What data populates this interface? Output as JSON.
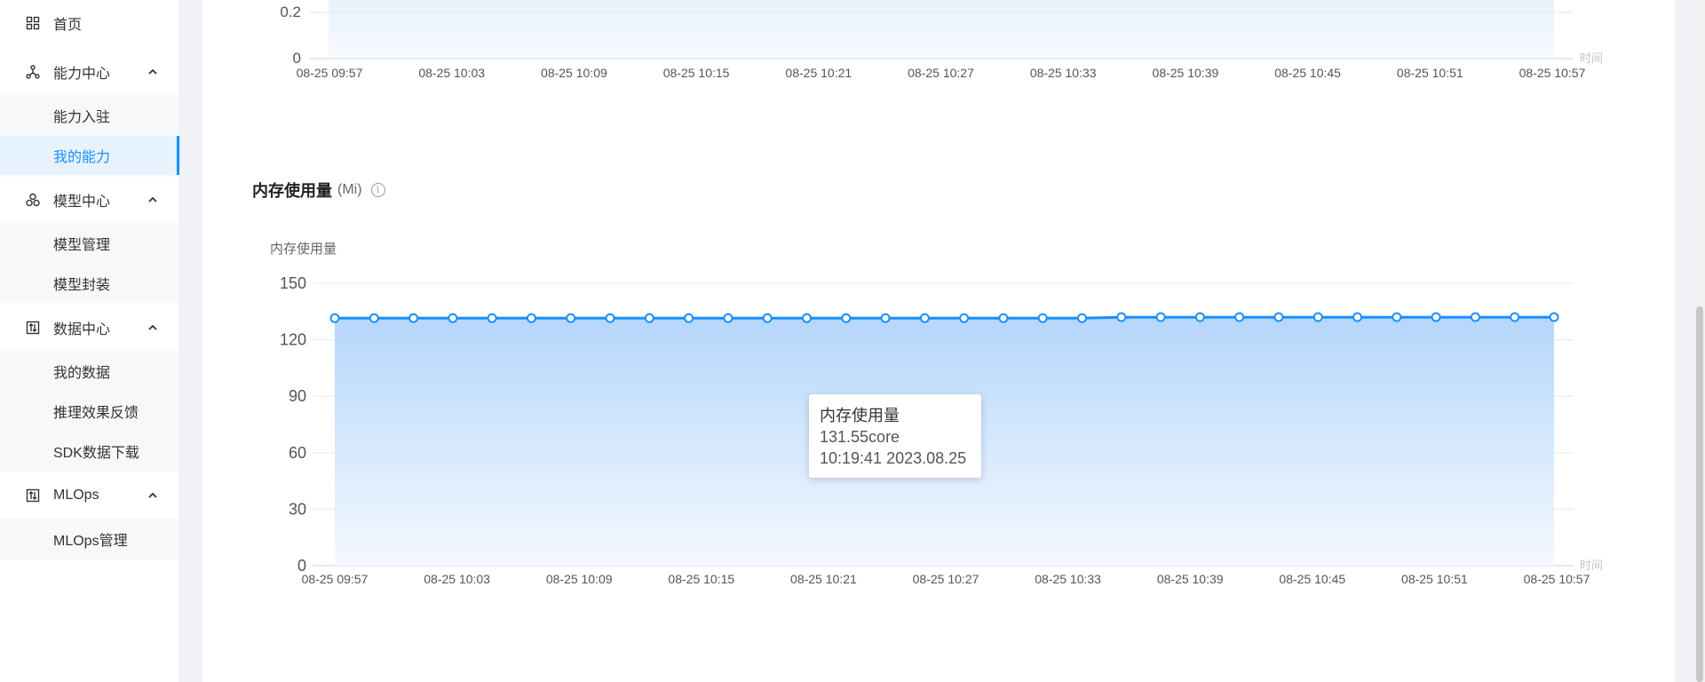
{
  "sidebar": {
    "home": {
      "label": "首页",
      "icon": "grid-icon"
    },
    "groups": [
      {
        "label": "能力中心",
        "icon": "nodes-icon",
        "items": [
          "能力入驻",
          "我的能力"
        ]
      },
      {
        "label": "模型中心",
        "icon": "model-icon",
        "items": [
          "模型管理",
          "模型封装"
        ]
      },
      {
        "label": "数据中心",
        "icon": "data-icon",
        "items": [
          "我的数据",
          "推理效果反馈",
          "SDK数据下载"
        ]
      },
      {
        "label": "MLOps",
        "icon": "mlops-icon",
        "items": [
          "MLOps管理"
        ]
      }
    ],
    "active_item": "我的能力",
    "accent_color": "#1890ff"
  },
  "top_chart": {
    "y_ticks": [
      "0.2",
      "0"
    ],
    "x_ticks": [
      "08-25 09:57",
      "08-25 10:03",
      "08-25 10:09",
      "08-25 10:15",
      "08-25 10:21",
      "08-25 10:27",
      "08-25 10:33",
      "08-25 10:39",
      "08-25 10:45",
      "08-25 10:51",
      "08-25 10:57"
    ],
    "x_axis_name": "时间"
  },
  "memory_section": {
    "title": "内存使用量",
    "unit": "(Mi)",
    "info_icon": "info-icon"
  },
  "chart_data": {
    "type": "area",
    "title": "",
    "ylabel": "内存使用量",
    "xlabel": "时间",
    "ylim": [
      0,
      150
    ],
    "y_ticks": [
      0,
      30,
      60,
      90,
      120,
      150
    ],
    "x_ticks": [
      "08-25 09:57",
      "08-25 10:03",
      "08-25 10:09",
      "08-25 10:15",
      "08-25 10:21",
      "08-25 10:27",
      "08-25 10:33",
      "08-25 10:39",
      "08-25 10:45",
      "08-25 10:51",
      "08-25 10:57"
    ],
    "series": [
      {
        "values": [
          131.5,
          131.5,
          131.5,
          131.5,
          131.5,
          131.5,
          131.5,
          131.5,
          131.5,
          131.5,
          131.5,
          131.5,
          131.5,
          131.5,
          131.5,
          131.5,
          131.5,
          131.5,
          131.5,
          131.5,
          132,
          132,
          132,
          132,
          132,
          132,
          132,
          132,
          132,
          132,
          132,
          132
        ],
        "color": "#1890ff"
      }
    ],
    "grid": true
  },
  "tooltip": {
    "title": "内存使用量",
    "value": "131.55core",
    "time": "10:19:41 2023.08.25"
  }
}
